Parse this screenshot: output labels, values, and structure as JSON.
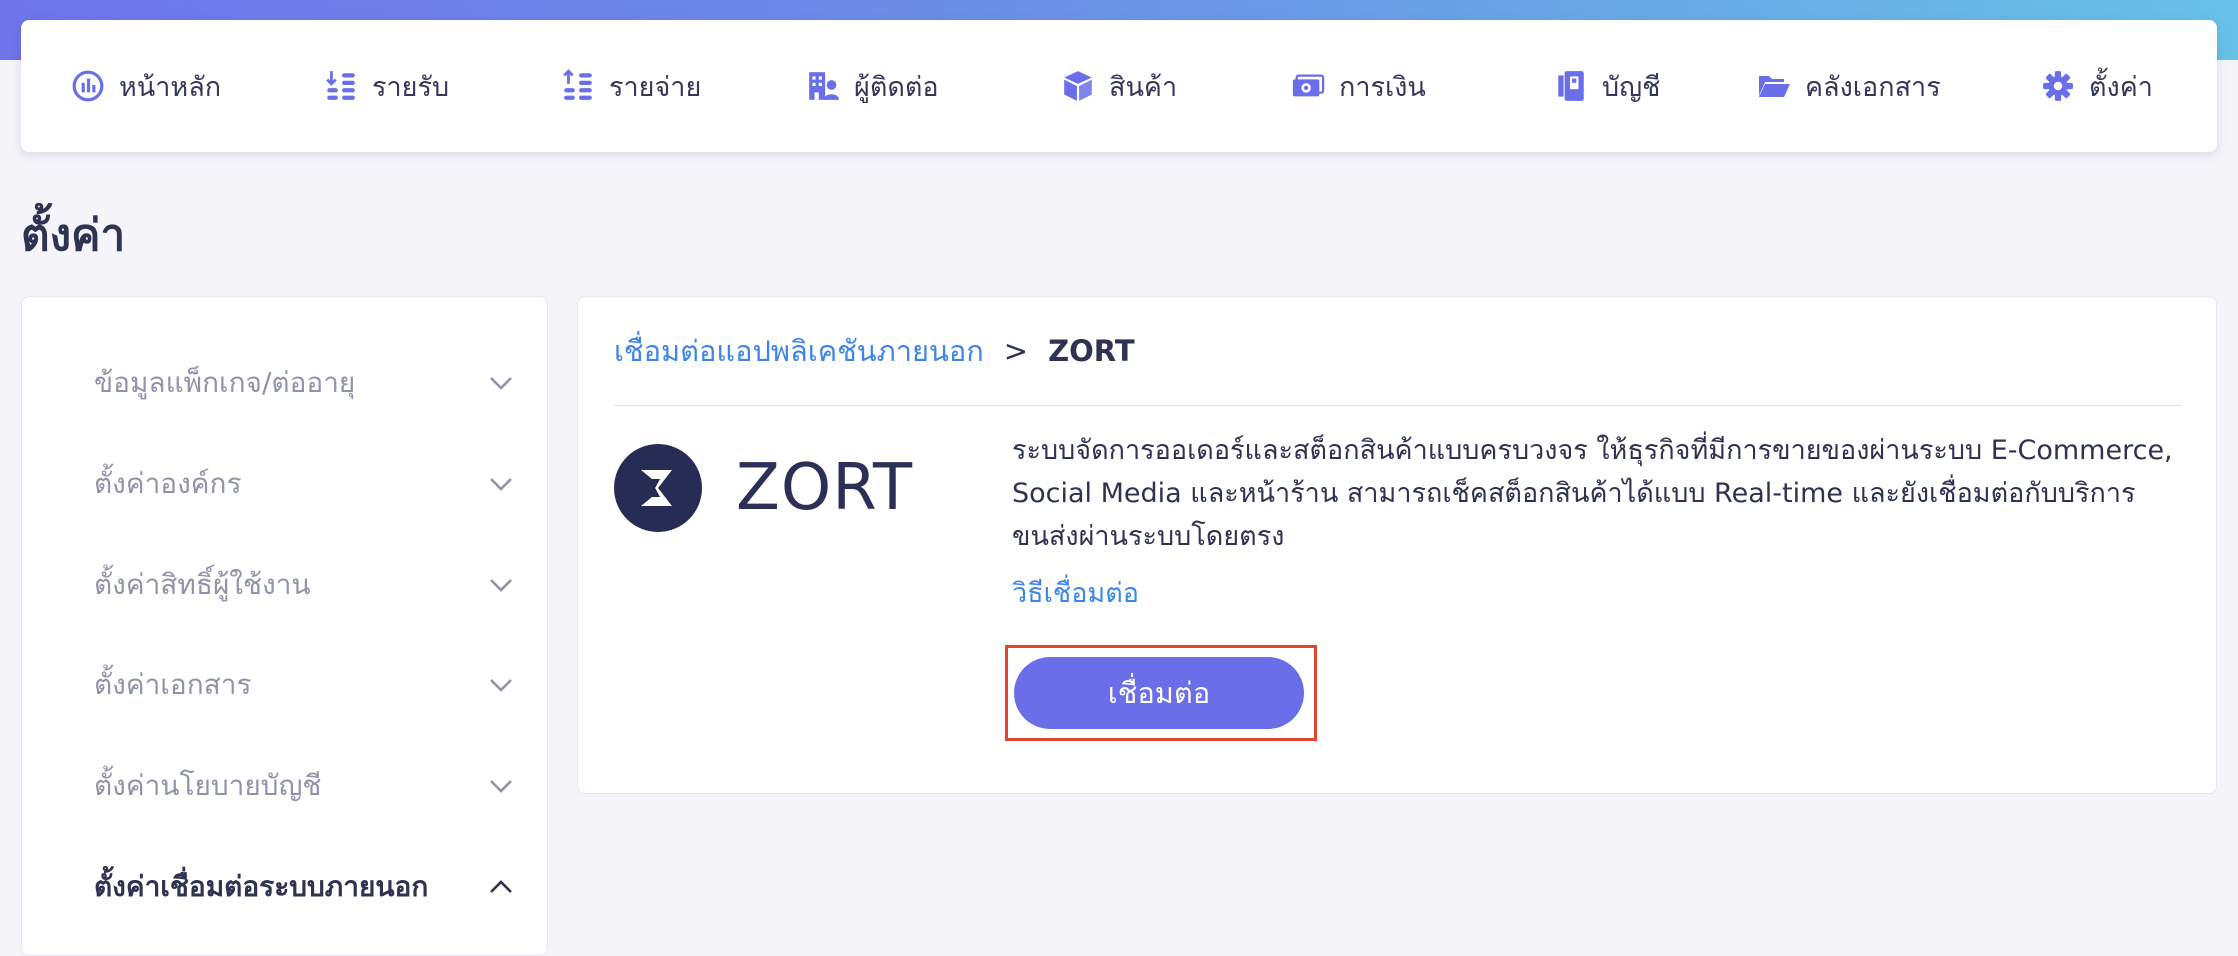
{
  "nav": {
    "items": [
      {
        "label": "หน้าหลัก",
        "icon": "dashboard-icon"
      },
      {
        "label": "รายรับ",
        "icon": "income-coins-icon"
      },
      {
        "label": "รายจ่าย",
        "icon": "expense-coins-icon"
      },
      {
        "label": "ผู้ติดต่อ",
        "icon": "contacts-building-icon"
      },
      {
        "label": "สินค้า",
        "icon": "product-box-icon"
      },
      {
        "label": "การเงิน",
        "icon": "money-bill-icon"
      },
      {
        "label": "บัญชี",
        "icon": "ledger-book-icon"
      },
      {
        "label": "คลังเอกสาร",
        "icon": "folder-open-icon"
      },
      {
        "label": "ตั้งค่า",
        "icon": "gear-icon"
      }
    ],
    "icon_color": "#6a6ee9"
  },
  "page": {
    "title": "ตั้งค่า"
  },
  "sidebar": {
    "items": [
      {
        "label": "ข้อมูลแพ็กเกจ/ต่ออายุ",
        "icon": "chevron-down-icon"
      },
      {
        "label": "ตั้งค่าองค์กร",
        "icon": "chevron-down-icon"
      },
      {
        "label": "ตั้งค่าสิทธิ์ผู้ใช้งาน",
        "icon": "chevron-down-icon"
      },
      {
        "label": "ตั้งค่าเอกสาร",
        "icon": "chevron-down-icon"
      },
      {
        "label": "ตั้งค่านโยบายบัญชี",
        "icon": "chevron-down-icon"
      },
      {
        "label": "ตั้งค่าเชื่อมต่อระบบภายนอก",
        "icon": "chevron-up-icon",
        "active": true
      }
    ]
  },
  "main": {
    "breadcrumb": {
      "parent": "เชื่อมต่อแอปพลิเคชันภายนอก",
      "separator": ">",
      "current": "ZORT"
    },
    "app": {
      "logo_icon": "zort-logo-icon",
      "name": "ZORT",
      "description": "ระบบจัดการออเดอร์และสต็อกสินค้าแบบครบวงจร ให้ธุรกิจที่มีการขายของผ่านระบบ E-Commerce, Social Media และหน้าร้าน สามารถเช็คสต็อกสินค้าได้แบบ Real-time และยังเชื่อมต่อกับบริการขนส่งผ่านระบบโดยตรง",
      "howto_link": "วิธีเชื่อมต่อ",
      "connect_button": "เชื่อมต่อ"
    }
  },
  "colors": {
    "accent": "#6a6ee9",
    "link": "#3d86e8",
    "highlight_outline": "#e2462e"
  }
}
